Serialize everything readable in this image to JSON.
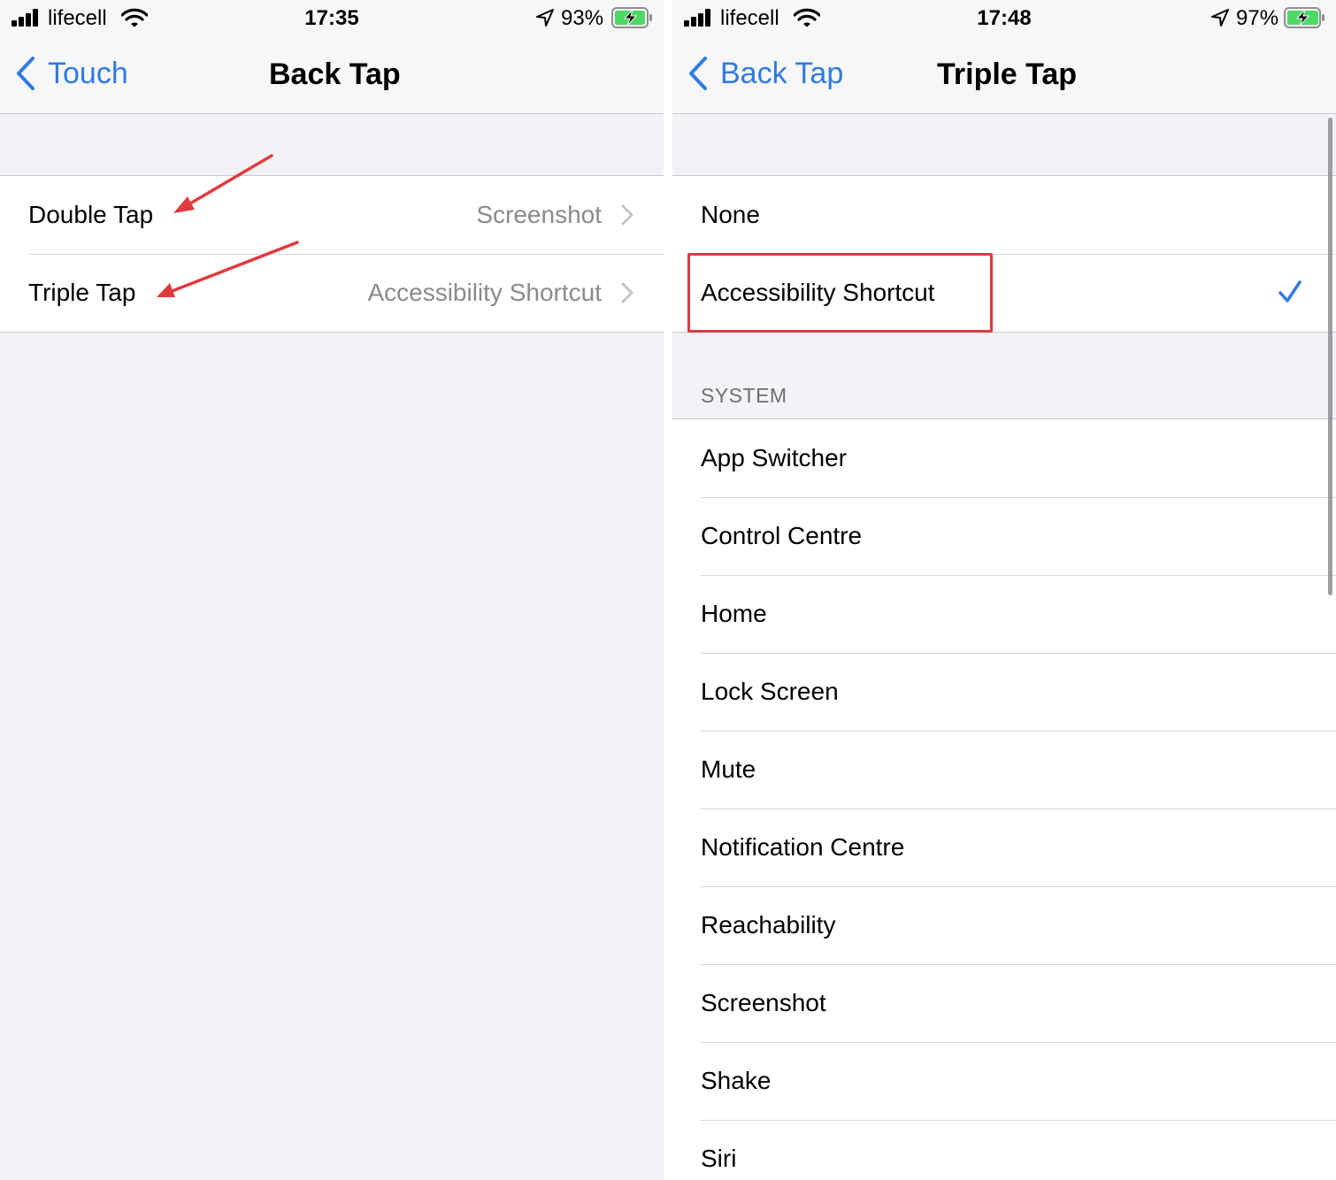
{
  "left": {
    "status": {
      "carrier": "lifecell",
      "time": "17:35",
      "battery_pct": "93%"
    },
    "nav": {
      "back_label": "Touch",
      "title": "Back Tap"
    },
    "rows": [
      {
        "label": "Double Tap",
        "value": "Screenshot"
      },
      {
        "label": "Triple Tap",
        "value": "Accessibility Shortcut"
      }
    ]
  },
  "right": {
    "status": {
      "carrier": "lifecell",
      "time": "17:48",
      "battery_pct": "97%"
    },
    "nav": {
      "back_label": "Back Tap",
      "title": "Triple Tap"
    },
    "top_options": [
      {
        "label": "None",
        "selected": false
      },
      {
        "label": "Accessibility Shortcut",
        "selected": true
      }
    ],
    "system_header": "SYSTEM",
    "system_options": [
      "App Switcher",
      "Control Centre",
      "Home",
      "Lock Screen",
      "Mute",
      "Notification Centre",
      "Reachability",
      "Screenshot",
      "Shake",
      "Siri"
    ]
  },
  "colors": {
    "accent": "#2f7ae5",
    "annotation": "#e03a3e",
    "battery_fill": "#4cd964",
    "secondary_text": "#8a8a8e"
  },
  "icons": {
    "signal": "cellular-signal-icon",
    "wifi": "wifi-icon",
    "location": "location-arrow-icon",
    "battery": "battery-charging-icon",
    "back": "chevron-left-icon",
    "disclosure": "chevron-right-icon",
    "selected": "checkmark-icon"
  }
}
